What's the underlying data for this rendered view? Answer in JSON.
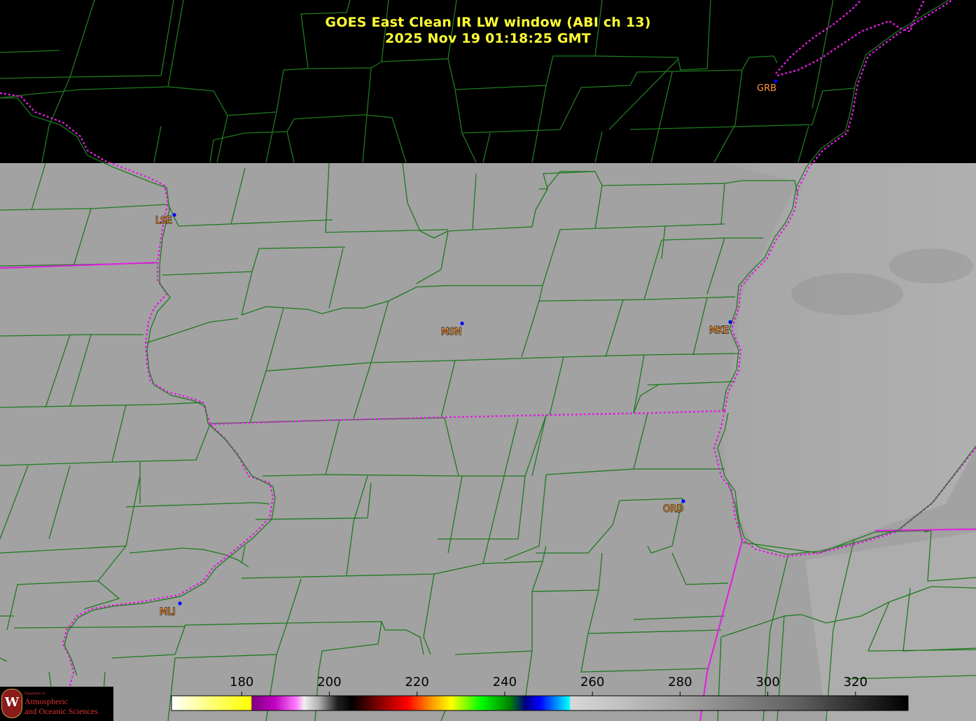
{
  "title": {
    "line1": "GOES East Clean IR LW window (ABI ch 13)",
    "line2": "2025 Nov 19  01:18:25 GMT"
  },
  "stations": [
    {
      "id": "GRB",
      "outlined": false
    },
    {
      "id": "LSE",
      "outlined": true
    },
    {
      "id": "MSN",
      "outlined": true
    },
    {
      "id": "MKE",
      "outlined": true
    },
    {
      "id": "ORD",
      "outlined": true
    },
    {
      "id": "MLI",
      "outlined": true
    }
  ],
  "colorbar": {
    "ticks": [
      "180",
      "200",
      "220",
      "240",
      "260",
      "280",
      "300",
      "320"
    ],
    "tick_values": [
      180,
      200,
      220,
      240,
      260,
      280,
      300,
      320
    ],
    "range": [
      164,
      332
    ]
  },
  "logo": {
    "letter": "W",
    "dept": "Department of",
    "line1": "Atmospheric",
    "line2": "and Oceanic Sciences"
  },
  "colors": {
    "title": "#ffff33",
    "county_lines": "#1e7a1e",
    "state_lines": "#e21de2",
    "station_label": "#ff9933",
    "station_dot": "#0000ff",
    "ir_field": "#a2a2a2"
  }
}
